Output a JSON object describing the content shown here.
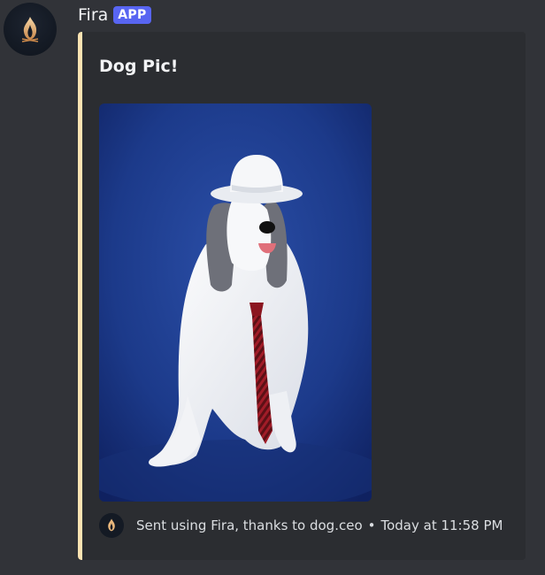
{
  "message": {
    "username": "Fira",
    "app_tag": "APP"
  },
  "embed": {
    "title": "Dog Pic!",
    "accent_color": "#fde3b2",
    "image_alt": "Dog wearing a white bowler hat and a striped red tie",
    "footer": {
      "text": "Sent using Fira, thanks to dog.ceo",
      "separator": "•",
      "timestamp": "Today at 11:58 PM"
    }
  },
  "icons": {
    "avatar": "fira-flame-logo-icon",
    "footer": "fira-flame-logo-icon"
  },
  "colors": {
    "background": "#313338",
    "embed_background": "#2b2d31",
    "app_tag": "#5865f2"
  }
}
